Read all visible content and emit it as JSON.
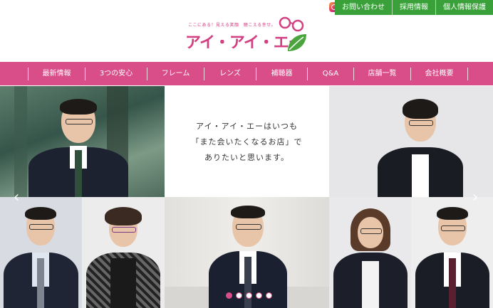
{
  "header": {
    "logo": {
      "tagline": "ここにある！見える笑顔　聴こえる幸せ。",
      "name": "アイ・アイ・エー"
    },
    "top_links": [
      "お問い合わせ",
      "採用情報",
      "個人情報保護"
    ],
    "instagram_icon": "instagram-icon"
  },
  "nav": {
    "items": [
      "最新情報",
      "3つの安心",
      "フレーム",
      "レンズ",
      "補聴器",
      "Q&A",
      "店舗一覧",
      "会社概要"
    ]
  },
  "hero": {
    "message": [
      "アイ・アイ・エーはいつも",
      "「また会いたくなるお店」で",
      "ありたいと思います。"
    ],
    "slide_count": 5,
    "active_slide": 1
  },
  "colors": {
    "brand_pink": "#d94d88",
    "brand_green": "#3aa13a"
  }
}
